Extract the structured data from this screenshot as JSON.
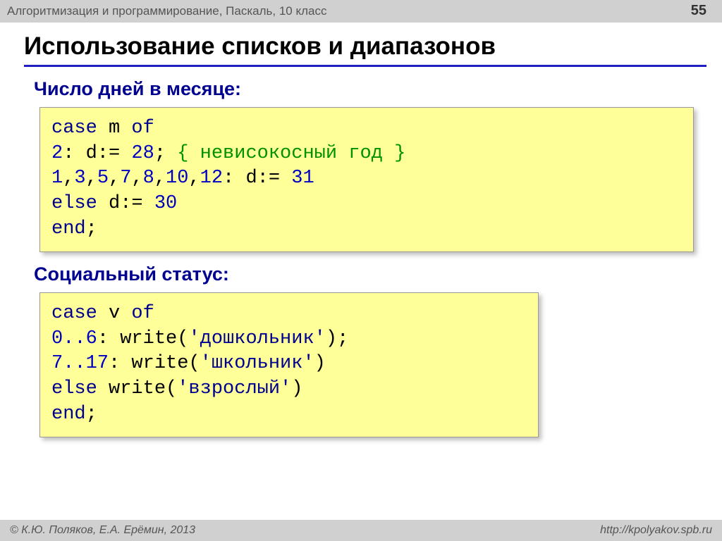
{
  "header": {
    "course": "Алгоритмизация и программирование, Паскаль, 10 класс",
    "page": "55"
  },
  "title": "Использование списков и диапазонов",
  "section1": {
    "heading": "Число дней в месяце:",
    "code": {
      "l1a": "case",
      "l1b": " m ",
      "l1c": "of",
      "l2a": " 2",
      "l2b": ": d:= ",
      "l2c": "28",
      "l2d": ";   ",
      "l2e": "{ невисокосный год }",
      "l3a": " 1",
      "l3b": ",",
      "l3c": "3",
      "l3d": ",",
      "l3e": "5",
      "l3f": ",",
      "l3g": "7",
      "l3h": ",",
      "l3i": "8",
      "l3j": ",",
      "l3k": "10",
      "l3l": ",",
      "l3m": "12",
      "l3n": ": d:= ",
      "l3o": "31",
      "l4a": " else",
      "l4b": " d:= ",
      "l4c": "30",
      "l5a": "end",
      "l5b": ";"
    }
  },
  "section2": {
    "heading": "Социальный статус:",
    "code": {
      "l1a": "case",
      "l1b": " v ",
      "l1c": "of",
      "l2a": " 0..6",
      "l2b": ":  write(",
      "l2c": "'дошкольник'",
      "l2d": ");",
      "l3a": " 7..17",
      "l3b": ": write(",
      "l3c": "'школьник'",
      "l3d": ")",
      "l4a": " else",
      "l4b": "   write(",
      "l4c": "'взрослый'",
      "l4d": ")",
      "l5a": "end",
      "l5b": ";"
    }
  },
  "footer": {
    "copyright": "© К.Ю. Поляков, Е.А. Ерёмин, 2013",
    "url": "http://kpolyakov.spb.ru"
  }
}
